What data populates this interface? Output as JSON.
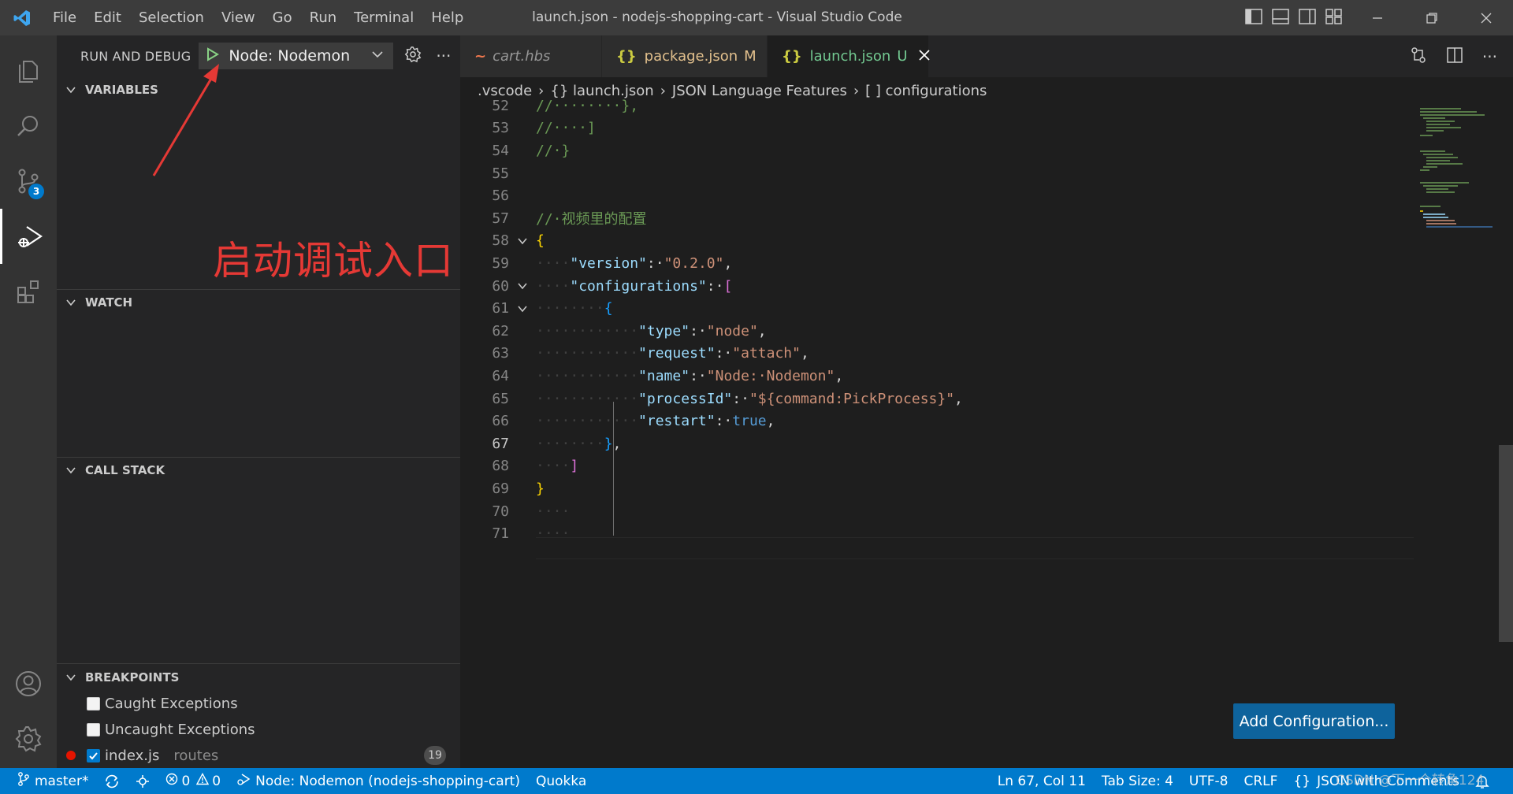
{
  "titlebar": {
    "menu": [
      "File",
      "Edit",
      "Selection",
      "View",
      "Go",
      "Run",
      "Terminal",
      "Help"
    ],
    "title": "launch.json - nodejs-shopping-cart - Visual Studio Code"
  },
  "activitybar": {
    "scm_badge": "3"
  },
  "sidebar": {
    "header_label": "RUN AND DEBUG",
    "config_name": "Node: Nodemon",
    "sections": {
      "variables": "VARIABLES",
      "watch": "WATCH",
      "call_stack": "CALL STACK",
      "breakpoints": "BREAKPOINTS"
    },
    "breakpoints": {
      "caught": "Caught Exceptions",
      "uncaught": "Uncaught Exceptions",
      "file": "index.js",
      "folder": "routes",
      "line": "19"
    }
  },
  "annotation": {
    "text": "启动调试入口",
    "color": "#e53935"
  },
  "tabs": [
    {
      "icon": "~",
      "label": "cart.hbs",
      "status": ""
    },
    {
      "icon": "{}",
      "label": "package.json",
      "status": "M"
    },
    {
      "icon": "{}",
      "label": "launch.json",
      "status": "U"
    }
  ],
  "breadcrumb": [
    ".vscode",
    "{} launch.json",
    "JSON Language Features",
    "[ ] configurations"
  ],
  "editor": {
    "lines": [
      {
        "n": "52",
        "tokens": [
          [
            "c-com",
            "//········},"
          ]
        ]
      },
      {
        "n": "53",
        "tokens": [
          [
            "c-com",
            "//····]"
          ]
        ]
      },
      {
        "n": "54",
        "tokens": [
          [
            "c-com",
            "//·}"
          ]
        ]
      },
      {
        "n": "55",
        "tokens": []
      },
      {
        "n": "56",
        "tokens": []
      },
      {
        "n": "57",
        "tokens": [
          [
            "c-com",
            "//·视频里的配置"
          ]
        ]
      },
      {
        "n": "58",
        "fold": true,
        "tokens": [
          [
            "c-br1",
            "{"
          ]
        ]
      },
      {
        "n": "59",
        "tokens": [
          [
            "c-ws",
            "····"
          ],
          [
            "c-key",
            "\"version\""
          ],
          [
            "c-pun",
            ":·"
          ],
          [
            "c-str",
            "\"0.2.0\""
          ],
          [
            "c-pun",
            ","
          ]
        ]
      },
      {
        "n": "60",
        "fold": true,
        "tokens": [
          [
            "c-ws",
            "····"
          ],
          [
            "c-key",
            "\"configurations\""
          ],
          [
            "c-pun",
            ":·"
          ],
          [
            "c-br2",
            "["
          ]
        ]
      },
      {
        "n": "61",
        "fold": true,
        "tokens": [
          [
            "c-ws",
            "········"
          ],
          [
            "c-br3",
            "{"
          ]
        ]
      },
      {
        "n": "62",
        "tokens": [
          [
            "c-ws",
            "············"
          ],
          [
            "c-key",
            "\"type\""
          ],
          [
            "c-pun",
            ":·"
          ],
          [
            "c-str",
            "\"node\""
          ],
          [
            "c-pun",
            ","
          ]
        ]
      },
      {
        "n": "63",
        "tokens": [
          [
            "c-ws",
            "············"
          ],
          [
            "c-key",
            "\"request\""
          ],
          [
            "c-pun",
            ":·"
          ],
          [
            "c-str",
            "\"attach\""
          ],
          [
            "c-pun",
            ","
          ]
        ]
      },
      {
        "n": "64",
        "tokens": [
          [
            "c-ws",
            "············"
          ],
          [
            "c-key",
            "\"name\""
          ],
          [
            "c-pun",
            ":·"
          ],
          [
            "c-str",
            "\"Node:·Nodemon\""
          ],
          [
            "c-pun",
            ","
          ]
        ]
      },
      {
        "n": "65",
        "tokens": [
          [
            "c-ws",
            "············"
          ],
          [
            "c-key",
            "\"processId\""
          ],
          [
            "c-pun",
            ":·"
          ],
          [
            "c-str",
            "\"${command:PickProcess}\""
          ],
          [
            "c-pun",
            ","
          ]
        ]
      },
      {
        "n": "66",
        "tokens": [
          [
            "c-ws",
            "············"
          ],
          [
            "c-key",
            "\"restart\""
          ],
          [
            "c-pun",
            ":·"
          ],
          [
            "c-kw",
            "true"
          ],
          [
            "c-pun",
            ","
          ]
        ]
      },
      {
        "n": "67",
        "current": true,
        "tokens": [
          [
            "c-ws",
            "········"
          ],
          [
            "c-br3",
            "}"
          ],
          [
            "c-pun",
            ","
          ]
        ]
      },
      {
        "n": "68",
        "tokens": [
          [
            "c-ws",
            "····"
          ],
          [
            "c-br2",
            "]"
          ]
        ]
      },
      {
        "n": "69",
        "tokens": [
          [
            "c-br1",
            "}"
          ]
        ]
      },
      {
        "n": "70",
        "tokens": [
          [
            "c-ws",
            "····"
          ]
        ]
      },
      {
        "n": "71",
        "tokens": [
          [
            "c-ws",
            "····"
          ]
        ]
      }
    ],
    "add_config_label": "Add Configuration..."
  },
  "statusbar": {
    "branch": "master*",
    "errors": "0",
    "warnings": "0",
    "debug_target": "Node: Nodemon (nodejs-shopping-cart)",
    "extension": "Quokka",
    "position": "Ln 67, Col 11",
    "tab_size": "Tab Size: 4",
    "encoding": "UTF-8",
    "eol": "CRLF",
    "language": "JSON with Comments",
    "watermark": "CSDN @下一个转角124"
  }
}
